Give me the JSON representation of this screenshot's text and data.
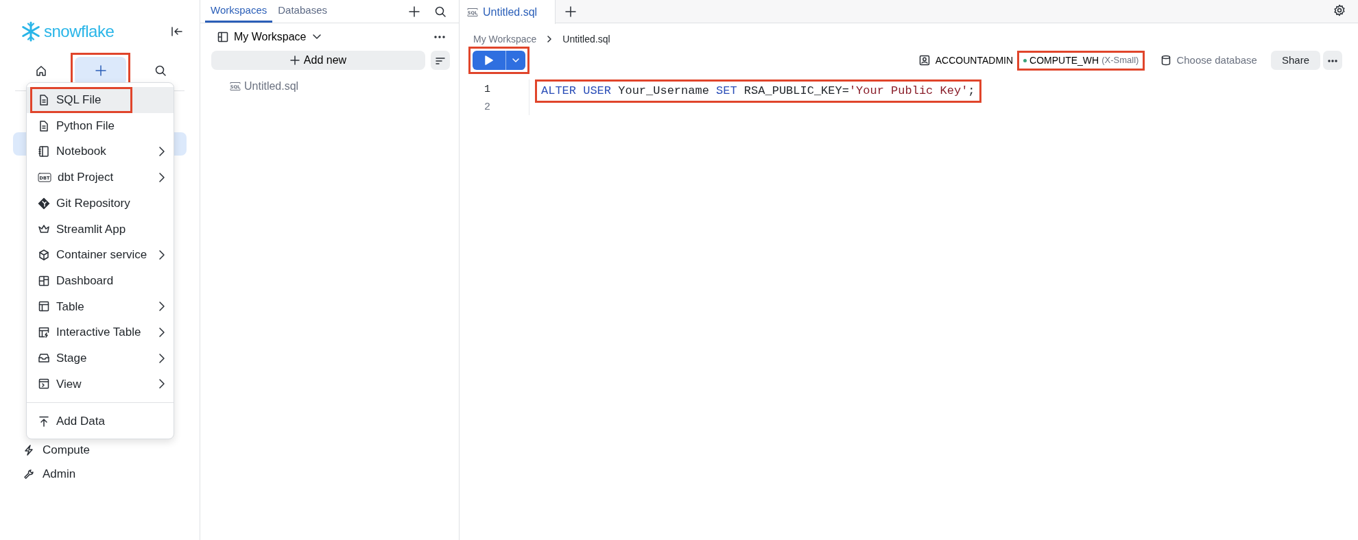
{
  "sidebar": {
    "logo": "snowflake",
    "nav": [
      {
        "selected": false,
        "highlighted": false
      },
      {
        "selected": true,
        "highlighted": true
      },
      {
        "selected": false,
        "highlighted": false
      }
    ],
    "has_selected_item": true,
    "items": [
      {
        "label": "Compute"
      },
      {
        "label": "Admin"
      }
    ]
  },
  "new_menu": {
    "items": [
      {
        "label": "SQL File",
        "has_submenu": false,
        "selected": true,
        "highlighted": true
      },
      {
        "label": "Python File",
        "has_submenu": false,
        "selected": false,
        "highlighted": false
      },
      {
        "label": "Notebook",
        "has_submenu": true,
        "selected": false,
        "highlighted": false
      },
      {
        "label": "dbt Project",
        "icon_text": "DBT",
        "has_submenu": true,
        "selected": false,
        "highlighted": false
      },
      {
        "label": "Git Repository",
        "has_submenu": false,
        "selected": false,
        "highlighted": false
      },
      {
        "label": "Streamlit App",
        "has_submenu": false,
        "selected": false,
        "highlighted": false
      },
      {
        "label": "Container service",
        "has_submenu": true,
        "selected": false,
        "highlighted": false
      },
      {
        "label": "Dashboard",
        "has_submenu": false,
        "selected": false,
        "highlighted": false
      },
      {
        "label": "Table",
        "has_submenu": true,
        "selected": false,
        "highlighted": false
      },
      {
        "label": "Interactive Table",
        "has_submenu": true,
        "selected": false,
        "highlighted": false
      },
      {
        "label": "Stage",
        "has_submenu": true,
        "selected": false,
        "highlighted": false
      },
      {
        "label": "View",
        "has_submenu": true,
        "selected": false,
        "highlighted": false
      }
    ],
    "footer_item": {
      "label": "Add Data"
    }
  },
  "files_panel": {
    "tabs": [
      {
        "label": "Workspaces",
        "selected": true
      },
      {
        "label": "Databases",
        "selected": false
      }
    ],
    "workspace": "My Workspace",
    "add_button": "Add new",
    "files": [
      {
        "label": "Untitled.sql",
        "icon_text": "SQL"
      }
    ]
  },
  "editor": {
    "tabs": [
      {
        "label": "Untitled.sql",
        "icon_text": "SQL",
        "selected": true
      }
    ],
    "breadcrumb": [
      "My Workspace",
      "Untitled.sql"
    ],
    "run_highlighted": true,
    "role": "ACCOUNTADMIN",
    "warehouse": {
      "name": "COMPUTE_WH",
      "size": "(X-Small)",
      "color": "#3aa27a",
      "highlighted": true
    },
    "database_placeholder": "Choose database",
    "share": "Share",
    "code_lines": [
      {
        "number": "1",
        "highlighted": true,
        "tokens": [
          {
            "text": "ALTER USER",
            "kind": "keyword"
          },
          {
            "text": " Your_Username ",
            "kind": "plain"
          },
          {
            "text": "SET",
            "kind": "keyword"
          },
          {
            "text": " RSA_PUBLIC_KEY=",
            "kind": "plain"
          },
          {
            "text": "'Your Public Key'",
            "kind": "string"
          },
          {
            "text": ";",
            "kind": "plain"
          }
        ]
      },
      {
        "number": "2",
        "highlighted": false
      }
    ]
  }
}
